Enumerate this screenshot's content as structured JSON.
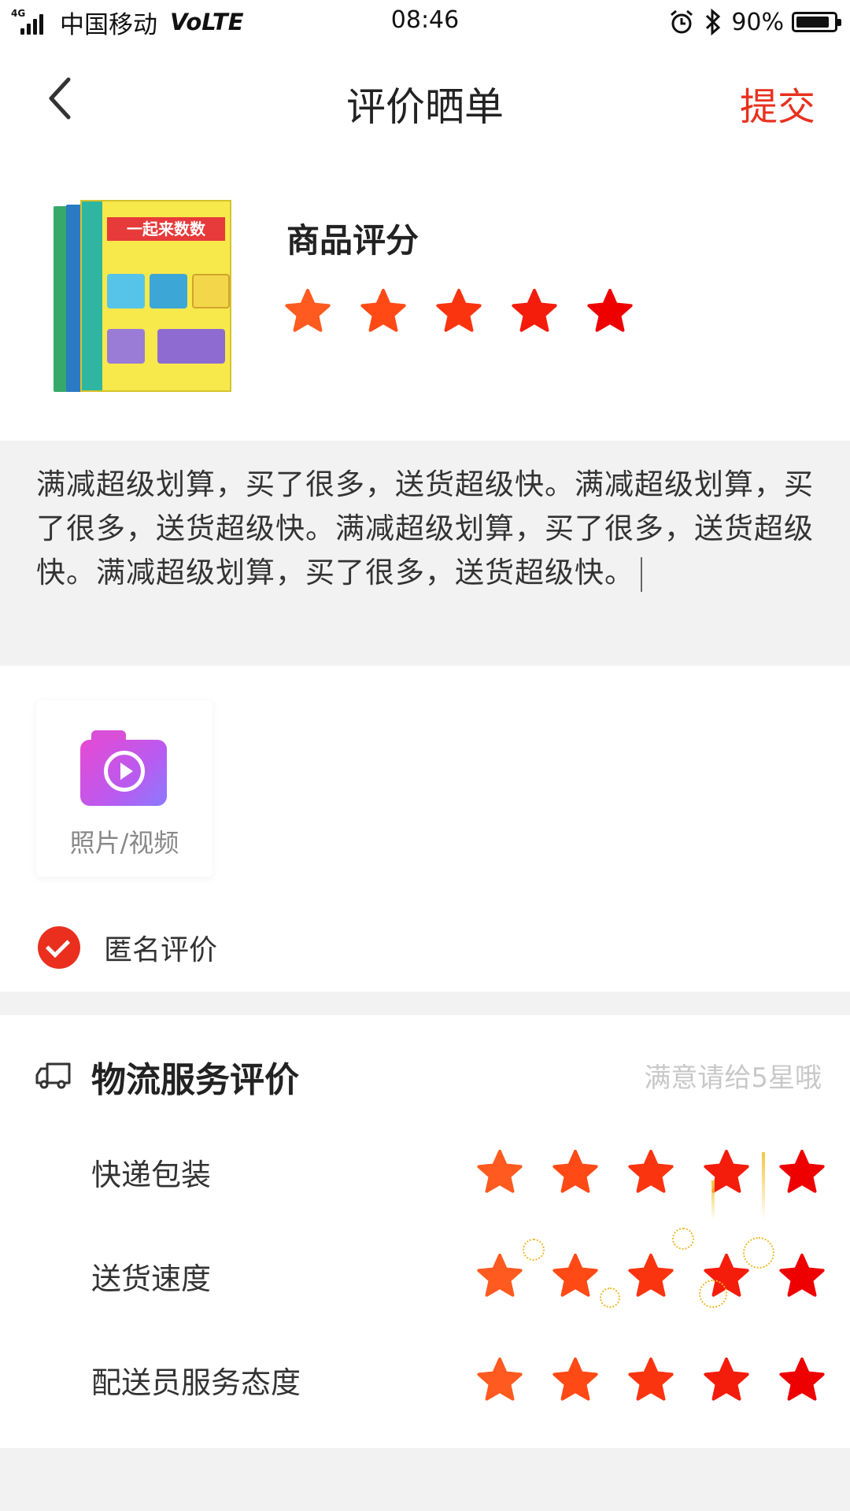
{
  "status_bar": {
    "network": "4G",
    "carrier": "中国移动",
    "volte": "VoLTE",
    "time": "08:46",
    "battery": "90%",
    "battery_level": 0.9,
    "icons": [
      "signal-icon",
      "alarm-icon",
      "bluetooth-icon",
      "battery-icon"
    ]
  },
  "header": {
    "back_icon": "chevron-left-icon",
    "title": "评价晒单",
    "submit_label": "提交"
  },
  "product": {
    "image": "book-cover-image",
    "rating_title": "商品评分",
    "rating": 5,
    "max_rating": 5
  },
  "review": {
    "text": "满减超级划算，买了很多，送货超级快。满减超级划算，买了很多，送货超级快。满减超级划算，买了很多，送货超级快。满减超级划算，买了很多，送货超级快。"
  },
  "media": {
    "upload_icon": "camera-video-icon",
    "upload_label": "照片/视频"
  },
  "anonymous": {
    "label": "匿名评价",
    "checked": true
  },
  "logistics": {
    "icon": "truck-icon",
    "title": "物流服务评价",
    "hint": "满意请给5星哦",
    "rows": [
      {
        "label": "快递包装",
        "rating": 5
      },
      {
        "label": "送货速度",
        "rating": 5
      },
      {
        "label": "配送员服务态度",
        "rating": 5
      }
    ]
  },
  "colors": {
    "accent_red": "#e8311e",
    "star_colors": [
      "#ff5a1f",
      "#ff4a16",
      "#fb3410",
      "#f41c0b",
      "#ef0000"
    ]
  }
}
